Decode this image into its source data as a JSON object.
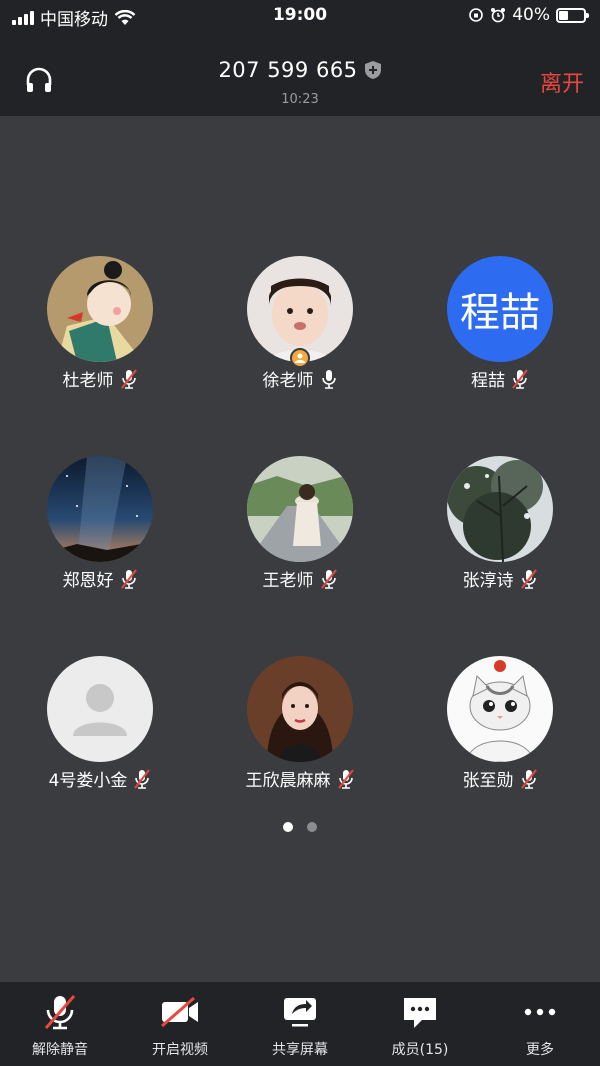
{
  "status_bar": {
    "carrier": "中国移动",
    "time": "19:00",
    "battery": "40%"
  },
  "header": {
    "meeting_id": "207 599 665",
    "duration": "10:23",
    "leave_label": "离开"
  },
  "participants": [
    {
      "name": "杜老师",
      "mic": "muted",
      "avatar": "cartoon-girl"
    },
    {
      "name": "徐老师",
      "mic": "on",
      "avatar": "child-photo",
      "host": true
    },
    {
      "name": "程喆",
      "mic": "muted",
      "avatar": "initials",
      "initials": "程喆",
      "avatar_color": "#2d6bf0"
    },
    {
      "name": "郑恩好",
      "mic": "muted",
      "avatar": "night-sky"
    },
    {
      "name": "王老师",
      "mic": "muted",
      "avatar": "road-photo"
    },
    {
      "name": "张淳诗",
      "mic": "muted",
      "avatar": "tree-photo"
    },
    {
      "name": "4号娄小金",
      "mic": "muted",
      "avatar": "default-person"
    },
    {
      "name": "王欣晨麻麻",
      "mic": "muted",
      "avatar": "woman-photo"
    },
    {
      "name": "张至勋",
      "mic": "muted",
      "avatar": "cat-drawing"
    }
  ],
  "pager": {
    "pages": 2,
    "current": 1
  },
  "toolbar": {
    "unmute_label": "解除静音",
    "video_label": "开启视频",
    "share_label": "共享屏幕",
    "members_label": "成员(15)",
    "more_label": "更多"
  },
  "colors": {
    "accent_red": "#e8483f",
    "host_badge": "#f2a93b",
    "mic_on": "#ffffff"
  }
}
